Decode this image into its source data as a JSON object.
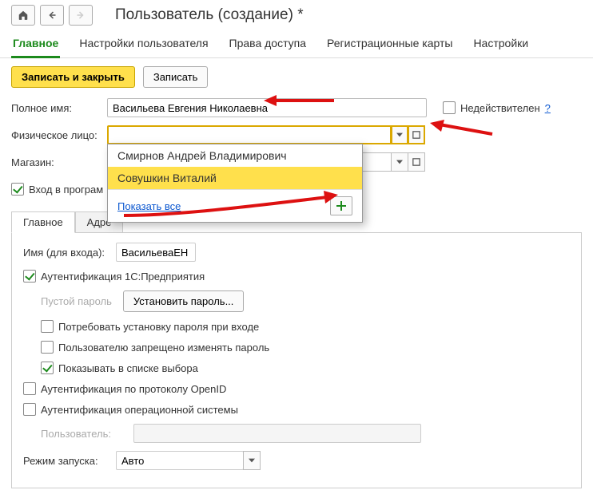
{
  "title": "Пользователь (создание) *",
  "maintabs": [
    "Главное",
    "Настройки пользователя",
    "Права доступа",
    "Регистрационные карты",
    "Настройки"
  ],
  "cmdbar": {
    "save_close": "Записать и закрыть",
    "save": "Записать"
  },
  "labels": {
    "fullname": "Полное имя:",
    "person": "Физическое лицо:",
    "store": "Магазин:",
    "invalid": "Недействителен",
    "help": "?",
    "login_allowed": "Вход в програм"
  },
  "values": {
    "fullname": "Васильева Евгения Николаевна"
  },
  "popup": {
    "items": [
      "Смирнов Андрей Владимирович",
      "Совушкин Виталий"
    ],
    "selected_index": 1,
    "show_all": "Показать все"
  },
  "inner_tabs": [
    "Главное",
    "Адре"
  ],
  "card": {
    "login_label": "Имя (для входа):",
    "login_value": "ВасильеваЕН",
    "auth_1c": "Аутентификация 1С:Предприятия",
    "empty_pwd": "Пустой пароль",
    "set_pwd": "Установить пароль...",
    "require_pwd": "Потребовать установку пароля при входе",
    "user_cannot_change": "Пользователю запрещено изменять пароль",
    "show_in_list": "Показывать в списке выбора",
    "auth_openid": "Аутентификация по протоколу OpenID",
    "auth_os": "Аутентификация операционной системы",
    "os_user": "Пользователь:",
    "mode_label": "Режим запуска:",
    "mode_value": "Авто"
  }
}
